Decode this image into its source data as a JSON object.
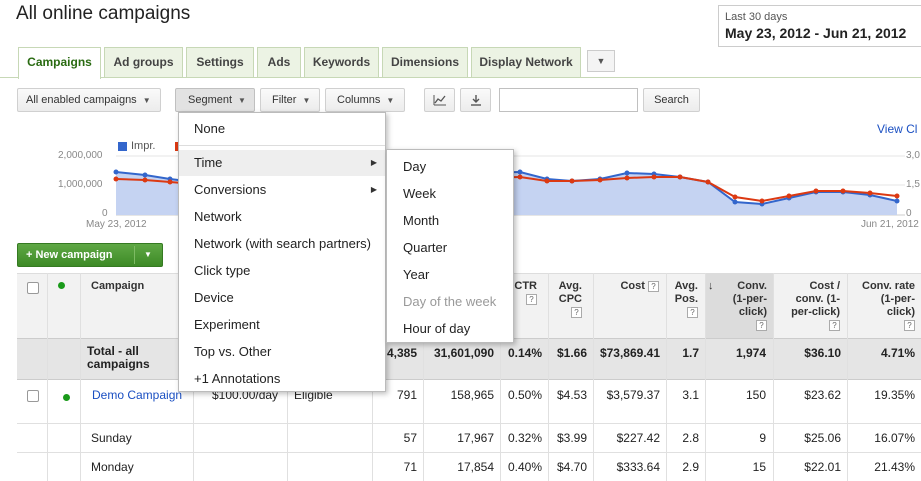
{
  "page_title": "All online campaigns",
  "date_range": {
    "label": "Last 30 days",
    "value": "May 23, 2012 - Jun 21, 2012"
  },
  "tabs": [
    "Campaigns",
    "Ad groups",
    "Settings",
    "Ads",
    "Keywords",
    "Dimensions",
    "Display Network"
  ],
  "toolbar": {
    "filter_status": "All enabled campaigns",
    "segment": "Segment",
    "filter": "Filter",
    "columns": "Columns",
    "search_button": "Search",
    "search_value": ""
  },
  "chart": {
    "legend": "Impr.",
    "view_link": "View Cl",
    "y_left_ticks": [
      "2,000,000",
      "1,000,000",
      "0"
    ],
    "y_right_ticks": [
      "3,0",
      "1,5",
      "0"
    ],
    "x_start": "May 23, 2012",
    "x_end": "Jun 21, 2012",
    "colors": {
      "impr": "#3366cc",
      "clicks": "#dc3912",
      "fill": "#c5d3f2"
    }
  },
  "new_campaign": "+ New campaign",
  "table": {
    "headers": {
      "campaign": "Campaign",
      "ctr": "CTR",
      "avg_cpc": [
        "Avg.",
        "CPC"
      ],
      "cost": "Cost",
      "avg_pos": [
        "Avg.",
        "Pos."
      ],
      "conv": [
        "Conv.",
        "(1-per-",
        "click)"
      ],
      "cost_conv": [
        "Cost /",
        "conv. (1-",
        "per-click)"
      ],
      "conv_rate": [
        "Conv. rate",
        "(1-per-",
        "click)"
      ]
    },
    "total": {
      "label": [
        "Total - all",
        "campaigns"
      ],
      "impr": "4,385",
      "impressions": "31,601,090",
      "ctr": "0.14%",
      "avg_cpc": "$1.66",
      "cost": "$73,869.41",
      "avg_pos": "1.7",
      "conv": "1,974",
      "cost_conv": "$36.10",
      "conv_rate": "4.71%"
    },
    "rows": [
      {
        "campaign": "Demo Campaign",
        "budget": "$100.00/day",
        "status": "Eligible",
        "clicks": "791",
        "impr": "158,965",
        "ctr": "0.50%",
        "cpc": "$4.53",
        "cost": "$3,579.37",
        "pos": "3.1",
        "conv": "150",
        "cost_conv": "$23.62",
        "rate": "19.35%"
      },
      {
        "campaign": "Sunday",
        "budget": "",
        "status": "",
        "clicks": "57",
        "impr": "17,967",
        "ctr": "0.32%",
        "cpc": "$3.99",
        "cost": "$227.42",
        "pos": "2.8",
        "conv": "9",
        "cost_conv": "$25.06",
        "rate": "16.07%"
      },
      {
        "campaign": "Monday",
        "budget": "",
        "status": "",
        "clicks": "71",
        "impr": "17,854",
        "ctr": "0.40%",
        "cpc": "$4.70",
        "cost": "$333.64",
        "pos": "2.9",
        "conv": "15",
        "cost_conv": "$22.01",
        "rate": "21.43%"
      }
    ]
  },
  "segment_menu": {
    "items": [
      "None",
      "Time",
      "Conversions",
      "Network",
      "Network (with search partners)",
      "Click type",
      "Device",
      "Experiment",
      "Top vs. Other",
      "+1 Annotations"
    ]
  },
  "time_submenu": {
    "items": [
      "Day",
      "Week",
      "Month",
      "Quarter",
      "Year",
      "Day of the week",
      "Hour of day"
    ]
  }
}
